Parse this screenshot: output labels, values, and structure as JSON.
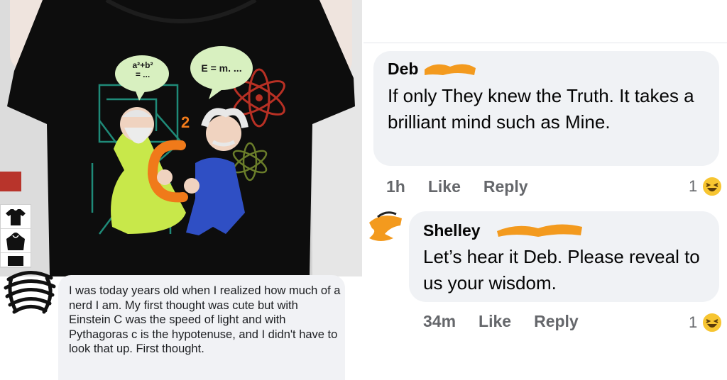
{
  "left_panel": {
    "shirt_bubbles": [
      "a²+b²\n= ...",
      "E = m. ..."
    ],
    "shirt_number": "2",
    "shirt_letter": "C",
    "left_comment_text": "I was today years old when I realized how much of a nerd I am. My first thought was cute but with Einstein C was the speed of light and with Pythagoras c is the hypotenuse, and I didn't have to look that up. First thought.",
    "swatch_icons": [
      "tshirt-icon",
      "hoodie-icon",
      "longsleeve-icon"
    ]
  },
  "thread": {
    "comments": [
      {
        "author": "Deb",
        "text": "If only They knew the Truth. It takes a brilliant mind such as Mine.",
        "time": "1h",
        "like_label": "Like",
        "reply_label": "Reply",
        "reaction_count": "1",
        "reaction_icon": "laughing-emoji-icon"
      },
      {
        "author": "Shelley",
        "text": "Let’s hear it Deb. Please reveal to us your wisdom.",
        "time": "34m",
        "like_label": "Like",
        "reply_label": "Reply",
        "reaction_count": "1",
        "reaction_icon": "laughing-emoji-icon"
      }
    ]
  },
  "colors": {
    "redaction": "#f39a1e",
    "bubble_bg": "#f0f2f5",
    "meta_text": "#65676b",
    "shirt": "#0d0d0d",
    "pythagoras_robe": "#c8e84a",
    "einstein_suit": "#2f4fc4",
    "equation_orange": "#f07a1a"
  }
}
